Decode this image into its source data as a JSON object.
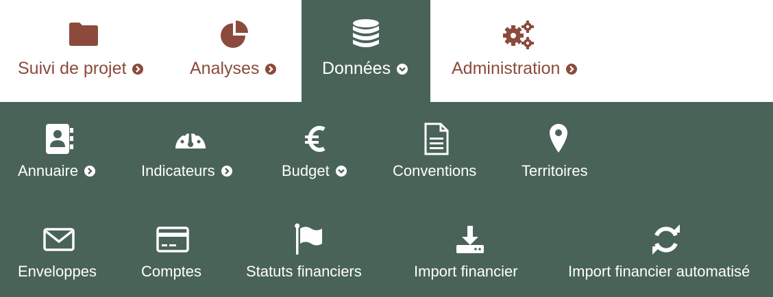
{
  "tabs": [
    {
      "label": "Suivi de projet",
      "icon": "folder-icon",
      "arrow": "arrow-right-circle-icon"
    },
    {
      "label": "Analyses",
      "icon": "pie-chart-icon",
      "arrow": "arrow-right-circle-icon"
    },
    {
      "label": "Données",
      "icon": "database-icon",
      "arrow": "arrow-down-circle-icon",
      "active": true
    },
    {
      "label": "Administration",
      "icon": "gears-icon",
      "arrow": "arrow-right-circle-icon"
    }
  ],
  "submenu": {
    "row1": [
      {
        "label": "Annuaire",
        "icon": "address-book-icon",
        "arrow": "arrow-right-circle-icon"
      },
      {
        "label": "Indicateurs",
        "icon": "dashboard-gauge-icon",
        "arrow": "arrow-right-circle-icon"
      },
      {
        "label": "Budget",
        "icon": "euro-icon",
        "arrow": "arrow-down-circle-icon"
      },
      {
        "label": "Conventions",
        "icon": "document-icon"
      },
      {
        "label": "Territoires",
        "icon": "map-marker-icon"
      }
    ],
    "row2": [
      {
        "label": "Enveloppes",
        "icon": "envelope-icon"
      },
      {
        "label": "Comptes",
        "icon": "credit-card-icon"
      },
      {
        "label": "Statuts financiers",
        "icon": "flag-icon"
      },
      {
        "label": "Import financier",
        "icon": "download-icon"
      },
      {
        "label": "Import financier automatisé",
        "icon": "refresh-icon"
      }
    ]
  },
  "colors": {
    "brand_brown": "#8b4a3c",
    "panel_green": "#4a6358",
    "white": "#ffffff"
  }
}
